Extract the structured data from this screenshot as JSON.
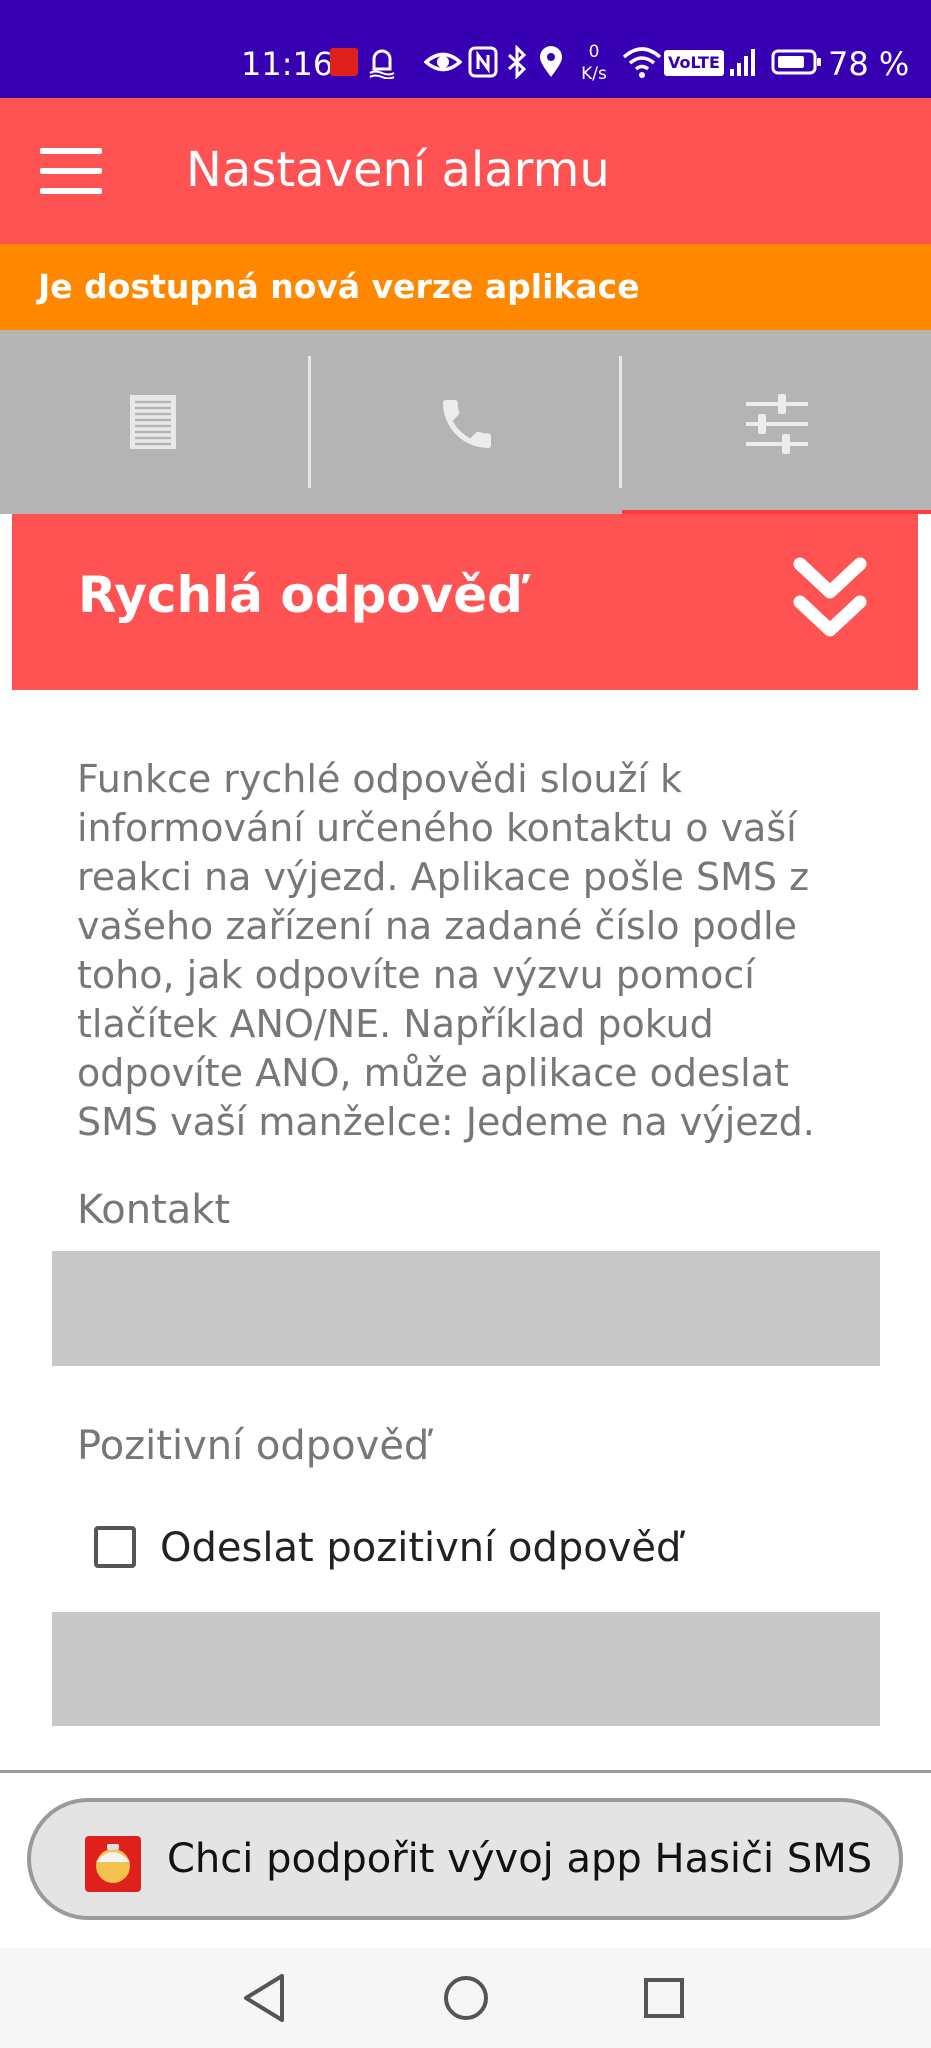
{
  "status_bar": {
    "time": "11:16",
    "net_speed_value": "0",
    "net_speed_unit": "K/s",
    "volte": "VoLTE",
    "battery": "78 %",
    "icons": [
      "app-notification-icon",
      "alarm-icon",
      "eye-icon",
      "nfc-icon",
      "bluetooth-icon",
      "location-icon",
      "wifi-icon",
      "signal-icon",
      "battery-icon"
    ]
  },
  "app_bar": {
    "title": "Nastavení alarmu",
    "menu_icon": "hamburger-menu-icon"
  },
  "update_banner": {
    "text": "Je dostupná nová verze aplikace"
  },
  "tabs": [
    {
      "icon": "document-icon",
      "selected": false
    },
    {
      "icon": "phone-icon",
      "selected": false
    },
    {
      "icon": "sliders-icon",
      "selected": true
    }
  ],
  "section": {
    "title": "Rychlá odpověď",
    "toggle_icon": "double-chevron-down-icon",
    "description": "Funkce rychlé odpovědi slouží k informování určeného kontaktu o vaší reakci na výjezd. Aplikace pošle SMS z vašeho zařízení na zadané číslo podle toho, jak odpovíte na výzvu pomocí tlačítek ANO/NE. Například pokud odpovíte ANO, může aplikace odeslat SMS vaší manželce: Jedeme na výjezd.",
    "contact_label": "Kontakt",
    "contact_value": "",
    "positive_label": "Pozitivní odpověď",
    "positive_checkbox_label": "Odeslat pozitivní odpověď",
    "positive_checked": false,
    "positive_value": ""
  },
  "support": {
    "label": "Chci podpořit vývoj app Hasiči SMS",
    "icon": "hasici-app-icon"
  },
  "nav_bar": {
    "buttons": [
      "back-icon",
      "home-icon",
      "recents-icon"
    ]
  },
  "colors": {
    "status_bar": "#3700b3",
    "primary": "#ff5252",
    "banner": "#ff8800",
    "tab_bar": "#b4b4b4",
    "input_bg": "#c8c8c8"
  }
}
